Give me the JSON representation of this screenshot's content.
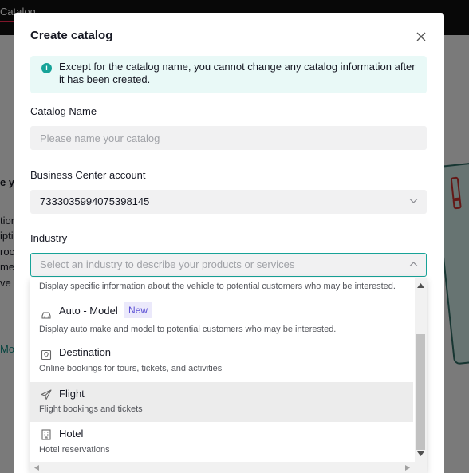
{
  "background": {
    "tab_label": "Catalog",
    "left_fragments": [
      "e yo",
      "tion",
      "ipti",
      "roc",
      "me",
      "ve"
    ],
    "link_fragment": "Mo"
  },
  "modal": {
    "title": "Create catalog",
    "info_text": "Except for the catalog name, you cannot change any catalog information after it has been created.",
    "catalog_name": {
      "label": "Catalog Name",
      "value": "",
      "placeholder": "Please name your catalog"
    },
    "business_center": {
      "label": "Business Center account",
      "value": "7333035994075398145"
    },
    "industry": {
      "label": "Industry",
      "placeholder": "Select an industry to describe your products or services"
    },
    "dropdown": {
      "partial_desc": "Display specific information about the vehicle to potential customers who may be interested.",
      "items": [
        {
          "title": "Auto - Model",
          "badge": "New",
          "desc": "Display auto make and model to potential customers who may be interested.",
          "icon": "car-icon"
        },
        {
          "title": "Destination",
          "desc": "Online bookings for tours, tickets, and activities",
          "icon": "map-pin-icon"
        },
        {
          "title": "Flight",
          "desc": "Flight bookings and tickets",
          "icon": "airplane-icon"
        },
        {
          "title": "Hotel",
          "desc": "Hotel reservations",
          "icon": "building-icon"
        }
      ]
    }
  },
  "colors": {
    "accent": "#17a398",
    "info_bg": "#e9f9f7",
    "badge_text": "#5b4fd4",
    "badge_bg": "#ebe9fb",
    "highlight_row": "#ececec"
  }
}
